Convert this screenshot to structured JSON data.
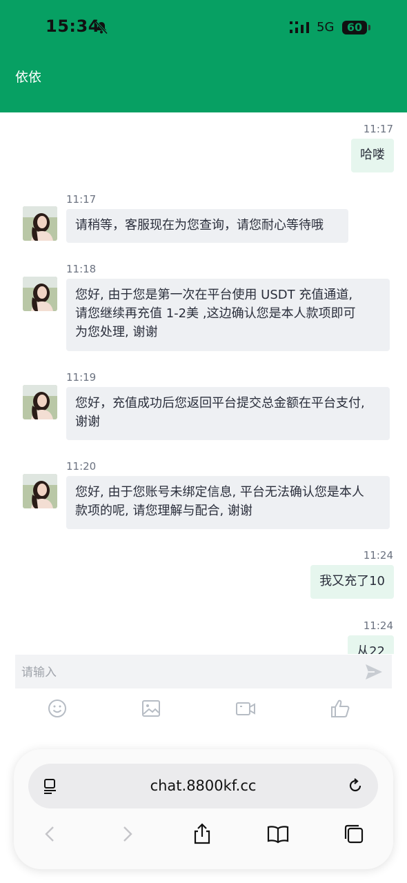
{
  "status_bar": {
    "time": "15:34",
    "network": "5G",
    "battery": "60"
  },
  "header": {
    "title": "依依"
  },
  "messages": [
    {
      "time": "11:17",
      "text": "哈喽"
    },
    {
      "time": "11:17",
      "text": "请稍等，客服现在为您查询，请您耐心等待哦"
    },
    {
      "time": "11:18",
      "lines": [
        "您好, 由于您是第一次在平台使用 USDT 充值通道,",
        "请您继续再充值 1-2美 ,这边确认您是本人款项即可",
        "为您处理, 谢谢"
      ]
    },
    {
      "time": "11:19",
      "lines": [
        "您好，充值成功后您返回平台提交总金额在平台支付,",
        "谢谢"
      ]
    },
    {
      "time": "11:20",
      "lines": [
        "您好, 由于您账号未绑定信息, 平台无法确认您是本人",
        "款项的呢, 请您理解与配合, 谢谢"
      ]
    },
    {
      "time": "11:24",
      "text": "我又充了10"
    },
    {
      "time": "11:24",
      "text": "从22"
    }
  ],
  "input": {
    "placeholder": "请输入"
  },
  "toolbar_icons": [
    "smile-icon",
    "image-icon",
    "video-icon",
    "thumbs-up-icon"
  ],
  "browser": {
    "url": "chat.8800kf.cc"
  },
  "colors": {
    "header": "#07a063",
    "incoming_bubble": "#eef0f3",
    "outgoing_bubble": "#e6f6ee"
  }
}
